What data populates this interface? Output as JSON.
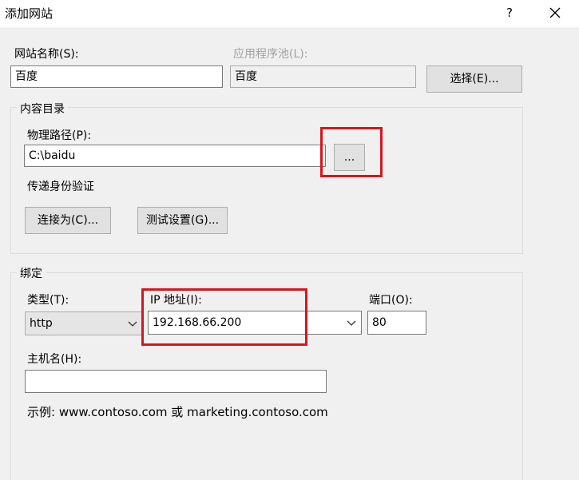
{
  "window": {
    "title": "添加网站",
    "help_label": "?",
    "close_icon": "close-icon"
  },
  "site": {
    "name_label": "网站名称(S):",
    "name_value": "百度",
    "pool_label": "应用程序池(L):",
    "pool_value": "百度",
    "select_button": "选择(E)..."
  },
  "content_dir": {
    "group_label": "内容目录",
    "path_label": "物理路径(P):",
    "path_value": "C:\\baidu",
    "browse_button": "...",
    "auth_label": "传递身份验证",
    "connect_button": "连接为(C)...",
    "test_button": "测试设置(G)..."
  },
  "binding": {
    "group_label": "绑定",
    "type_label": "类型(T):",
    "type_value": "http",
    "ip_label": "IP 地址(I):",
    "ip_value": "192.168.66.200",
    "port_label": "端口(O):",
    "port_value": "80",
    "host_label": "主机名(H):",
    "host_value": "",
    "example": "示例: www.contoso.com 或 marketing.contoso.com"
  },
  "colors": {
    "highlight": "#d9141b",
    "dialog_bg": "#f0f0f0"
  }
}
